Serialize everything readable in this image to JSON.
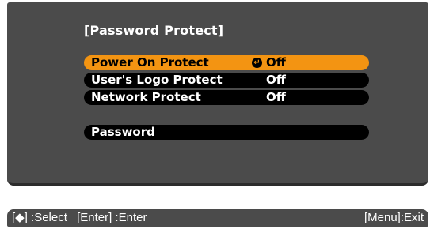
{
  "menu": {
    "title": "[Password Protect]",
    "items": [
      {
        "label": "Power On Protect",
        "value": "Off",
        "selected": true
      },
      {
        "label": "User's Logo Protect",
        "value": "Off",
        "selected": false
      },
      {
        "label": "Network Protect",
        "value": "Off",
        "selected": false
      }
    ],
    "password_label": "Password",
    "enter_icon": "enter-return-icon"
  },
  "footer": {
    "select": "[◆] :Select",
    "enter": "[Enter] :Enter",
    "exit": "[Menu]:Exit"
  },
  "colors": {
    "panel": "#4b4b4b",
    "row": "#000000",
    "highlight": "#f39412",
    "text": "#ffffff"
  }
}
